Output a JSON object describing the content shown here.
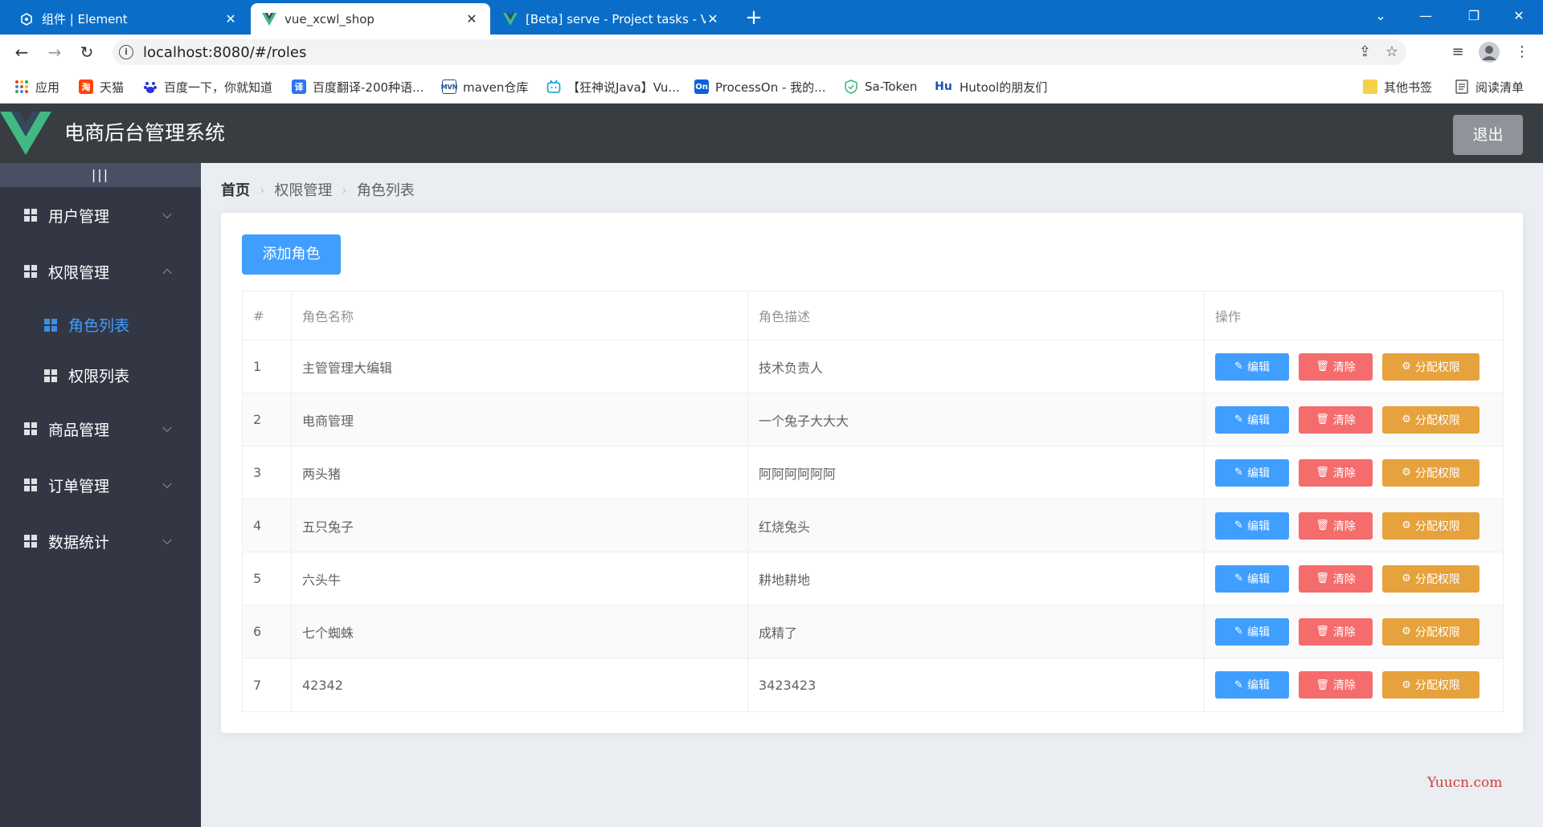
{
  "browser": {
    "tabs": [
      {
        "title": "组件 | Element",
        "icon": "element-icon",
        "active": false
      },
      {
        "title": "vue_xcwl_shop",
        "icon": "vue-icon",
        "active": true
      },
      {
        "title": "[Beta] serve - Project tasks - V",
        "icon": "vue-icon",
        "active": false
      }
    ],
    "url": "localhost:8080/#/roles",
    "bookmarks": [
      {
        "label": "应用",
        "icon": "apps-grid-icon"
      },
      {
        "label": "天猫",
        "icon": "tmall-icon"
      },
      {
        "label": "百度一下，你就知道",
        "icon": "baidu-icon"
      },
      {
        "label": "百度翻译-200种语...",
        "icon": "baidu-translate-icon"
      },
      {
        "label": "maven仓库",
        "icon": "maven-icon"
      },
      {
        "label": "【狂神说Java】Vu...",
        "icon": "bilibili-icon"
      },
      {
        "label": "ProcessOn - 我的...",
        "icon": "processon-icon"
      },
      {
        "label": "Sa-Token",
        "icon": "sa-token-icon"
      },
      {
        "label": "Hutool的朋友们",
        "icon": "hutool-icon"
      }
    ],
    "bookmarks_right": [
      {
        "label": "其他书签",
        "icon": "folder-icon"
      },
      {
        "label": "阅读清单",
        "icon": "reading-list-icon"
      }
    ],
    "bookmark_icon_text": {
      "tmall": "淘",
      "translate": "译",
      "maven": "MVN",
      "processon": "On",
      "hutool": "Hu"
    }
  },
  "app": {
    "title": "电商后台管理系统",
    "logout_label": "退出",
    "toggle_label": "|||",
    "menu": [
      {
        "label": "用户管理",
        "expanded": false
      },
      {
        "label": "权限管理",
        "expanded": true,
        "children": [
          {
            "label": "角色列表",
            "active": true
          },
          {
            "label": "权限列表",
            "active": false
          }
        ]
      },
      {
        "label": "商品管理",
        "expanded": false
      },
      {
        "label": "订单管理",
        "expanded": false
      },
      {
        "label": "数据统计",
        "expanded": false
      }
    ],
    "breadcrumb": [
      "首页",
      "权限管理",
      "角色列表"
    ],
    "add_button_label": "添加角色",
    "table": {
      "headers": [
        "#",
        "角色名称",
        "角色描述",
        "操作"
      ],
      "rows": [
        {
          "index": "1",
          "name": "主管管理大编辑",
          "desc": "技术负责人"
        },
        {
          "index": "2",
          "name": "电商管理",
          "desc": "一个兔子大大大"
        },
        {
          "index": "3",
          "name": "两头猪",
          "desc": "阿阿阿阿阿阿"
        },
        {
          "index": "4",
          "name": "五只兔子",
          "desc": "红烧兔头"
        },
        {
          "index": "5",
          "name": "六头牛",
          "desc": "耕地耕地"
        },
        {
          "index": "6",
          "name": "七个蜘蛛",
          "desc": "成精了"
        },
        {
          "index": "7",
          "name": "42342",
          "desc": "3423423"
        }
      ],
      "actions": {
        "edit": "编辑",
        "delete": "清除",
        "assign": "分配权限"
      }
    },
    "watermark": "Yuucn.com"
  },
  "colors": {
    "primary": "#409eff",
    "danger": "#f56c6c",
    "warning": "#e6a23c",
    "header_bg": "#373d41",
    "aside_bg": "#333744",
    "main_bg": "#eaedf1",
    "logout_bg": "#909399",
    "vue_green": "#42b883"
  }
}
